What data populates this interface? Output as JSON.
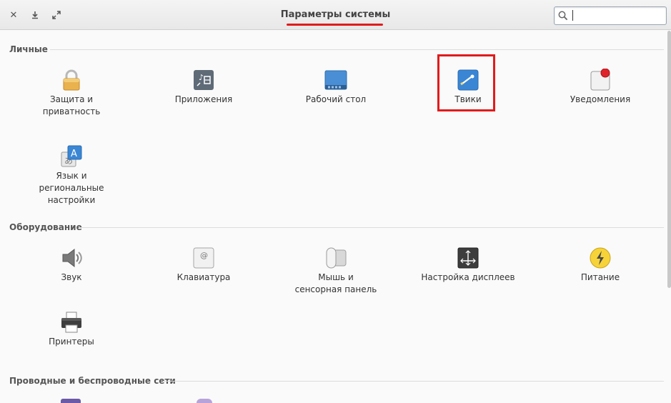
{
  "window": {
    "title": "Параметры системы",
    "search": {
      "placeholder": "",
      "value": ""
    }
  },
  "sections": [
    {
      "title": "Личные"
    },
    {
      "title": "Оборудование"
    },
    {
      "title": "Проводные и беспроводные сети"
    }
  ],
  "personal": [
    {
      "label": "Защита и\nприватность",
      "icon": "lock-icon"
    },
    {
      "label": "Приложения",
      "icon": "applications-icon"
    },
    {
      "label": "Рабочий стол",
      "icon": "desktop-icon"
    },
    {
      "label": "Твики",
      "icon": "tweaks-icon"
    },
    {
      "label": "Уведомления",
      "icon": "notifications-icon"
    },
    {
      "label": "Язык и\nрегиональные\nнастройки",
      "icon": "language-icon"
    }
  ],
  "hardware": [
    {
      "label": "Звук",
      "icon": "speaker-icon"
    },
    {
      "label": "Клавиатура",
      "icon": "keyboard-icon"
    },
    {
      "label": "Мышь и\nсенсорная панель",
      "icon": "mouse-icon"
    },
    {
      "label": "Настройка дисплеев",
      "icon": "display-icon"
    },
    {
      "label": "Питание",
      "icon": "power-icon"
    },
    {
      "label": "Принтеры",
      "icon": "printer-icon"
    }
  ],
  "colors": {
    "accent": "#e01b1b",
    "highlight": "#e01b1b"
  }
}
